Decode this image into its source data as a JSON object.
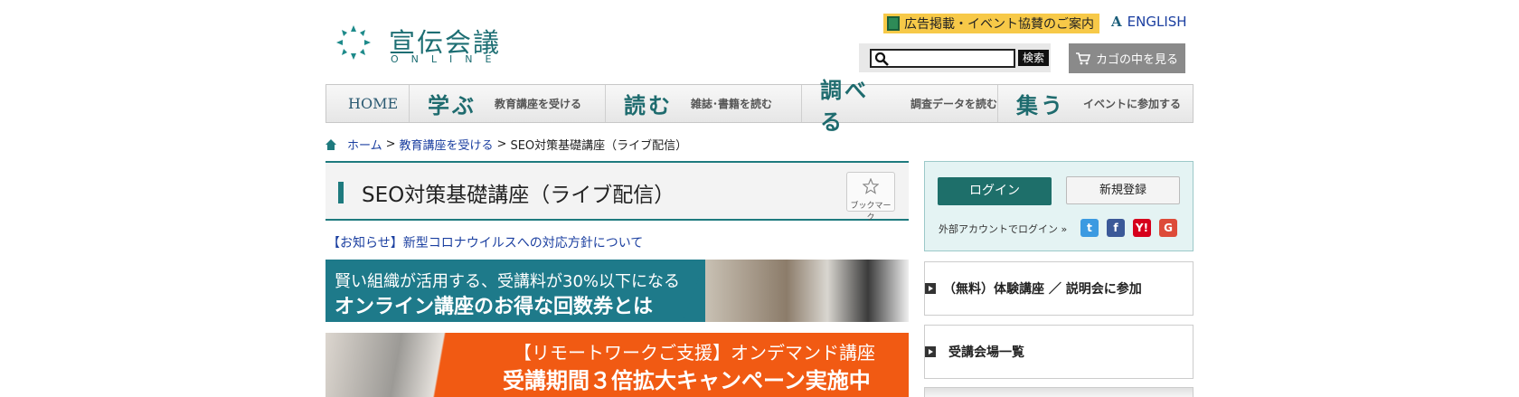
{
  "header": {
    "logo_title": "宣伝会議",
    "logo_sub": "ONLINE",
    "ad_link": "広告掲載・イベント協賛のご案内",
    "english_link": "ENGLISH",
    "search_button": "検索",
    "search_value": "",
    "cart_button": "カゴの中を見る"
  },
  "nav": {
    "home": "HOME",
    "items": [
      {
        "big": "学ぶ",
        "small": "教育講座を受ける"
      },
      {
        "big": "読む",
        "small": "雑誌･書籍を読む"
      },
      {
        "big": "調べる",
        "small": "調査データを読む"
      },
      {
        "big": "集う",
        "small": "イベントに参加する"
      }
    ]
  },
  "breadcrumb": {
    "home": "ホーム",
    "sep": ">",
    "level1": "教育講座を受ける",
    "current": "SEO対策基礎講座（ライブ配信）"
  },
  "main": {
    "title": "SEO対策基礎講座（ライブ配信）",
    "bookmark_label": "ブックマーク",
    "notice": "【お知らせ】新型コロナウイルスへの対応方針について",
    "banner1_line1": "賢い組織が活用する、受講料が30%以下になる",
    "banner1_line2": "オンライン講座のお得な回数券とは",
    "banner2_line1": "【リモートワークご支援】オンデマンド講座",
    "banner2_line2": "受講期間３倍拡大キャンペーン実施中"
  },
  "sidebar": {
    "login_button": "ログイン",
    "register_button": "新規登録",
    "external_login": "外部アカウントでログイン »",
    "sns": {
      "twitter": "t",
      "facebook": "f",
      "yahoo": "Y!",
      "google": "G"
    },
    "links": [
      {
        "label": "（無料）体験講座 ／ 説明会に参加"
      },
      {
        "label": "受講会場一覧"
      }
    ]
  },
  "colors": {
    "brand_teal": "#1e7a7e",
    "link_blue": "#1b3fa0",
    "ad_yellow": "#f7c948",
    "banner_orange": "#f15a13"
  }
}
